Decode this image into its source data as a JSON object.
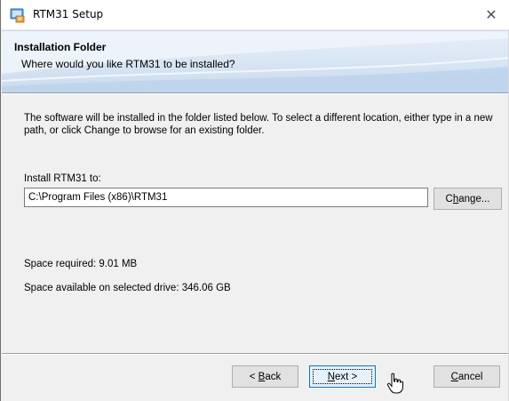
{
  "window": {
    "title": "RTM31 Setup",
    "close_glyph": "✕"
  },
  "banner": {
    "title": "Installation Folder",
    "subtitle": "Where would you like RTM31 to be installed?"
  },
  "content": {
    "description": "The software will be installed in the folder listed below. To select a different location, either type in a new path, or click Change to browse for an existing folder.",
    "install_label": "Install RTM31 to:",
    "install_path": "C:\\Program Files (x86)\\RTM31",
    "change_button": {
      "pre": "C",
      "accel": "h",
      "post": "ange..."
    },
    "space_required": "Space required: 9.01 MB",
    "space_available": "Space available on selected drive: 346.06 GB"
  },
  "footer": {
    "back_button": {
      "pre": "< ",
      "accel": "B",
      "post": "ack"
    },
    "next_button": {
      "pre": "",
      "accel": "N",
      "post": "ext >"
    },
    "cancel_button": {
      "pre": "",
      "accel": "C",
      "post": "ancel"
    }
  },
  "icons": {
    "app": "setup-installer-icon",
    "close": "close-icon",
    "cursor": "mouse-pointer-icon"
  },
  "colors": {
    "focus_border": "#0078d7",
    "button_bg": "#e1e1e1",
    "window_bg": "#f0f0f0"
  }
}
